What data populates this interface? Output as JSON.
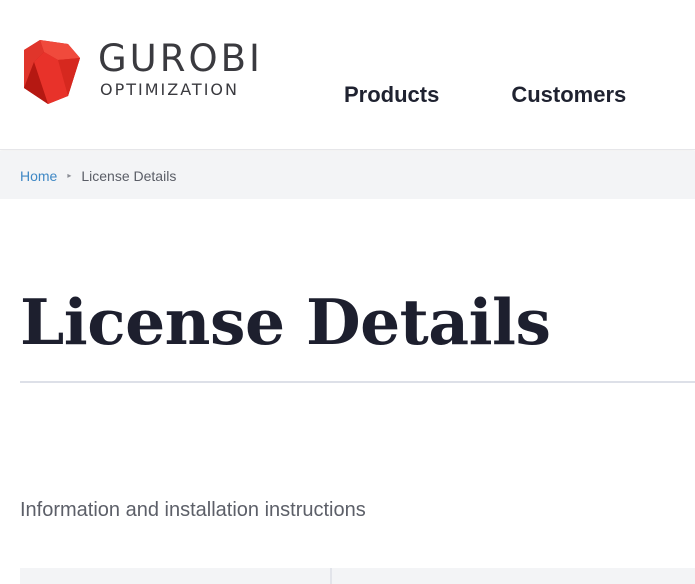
{
  "header": {
    "logo": {
      "name": "GUROBI",
      "tagline": "OPTIMIZATION",
      "mark_color": "#e8322a"
    },
    "nav": [
      {
        "label": "Products"
      },
      {
        "label": "Customers"
      }
    ]
  },
  "breadcrumb": {
    "home": "Home",
    "separator": "▸",
    "current": "License Details"
  },
  "main": {
    "title": "License Details",
    "subtitle": "Information and installation instructions"
  },
  "colors": {
    "link": "#3f88c5",
    "title": "#1d1f2e",
    "breadcrumb_bg": "#f3f4f6"
  }
}
